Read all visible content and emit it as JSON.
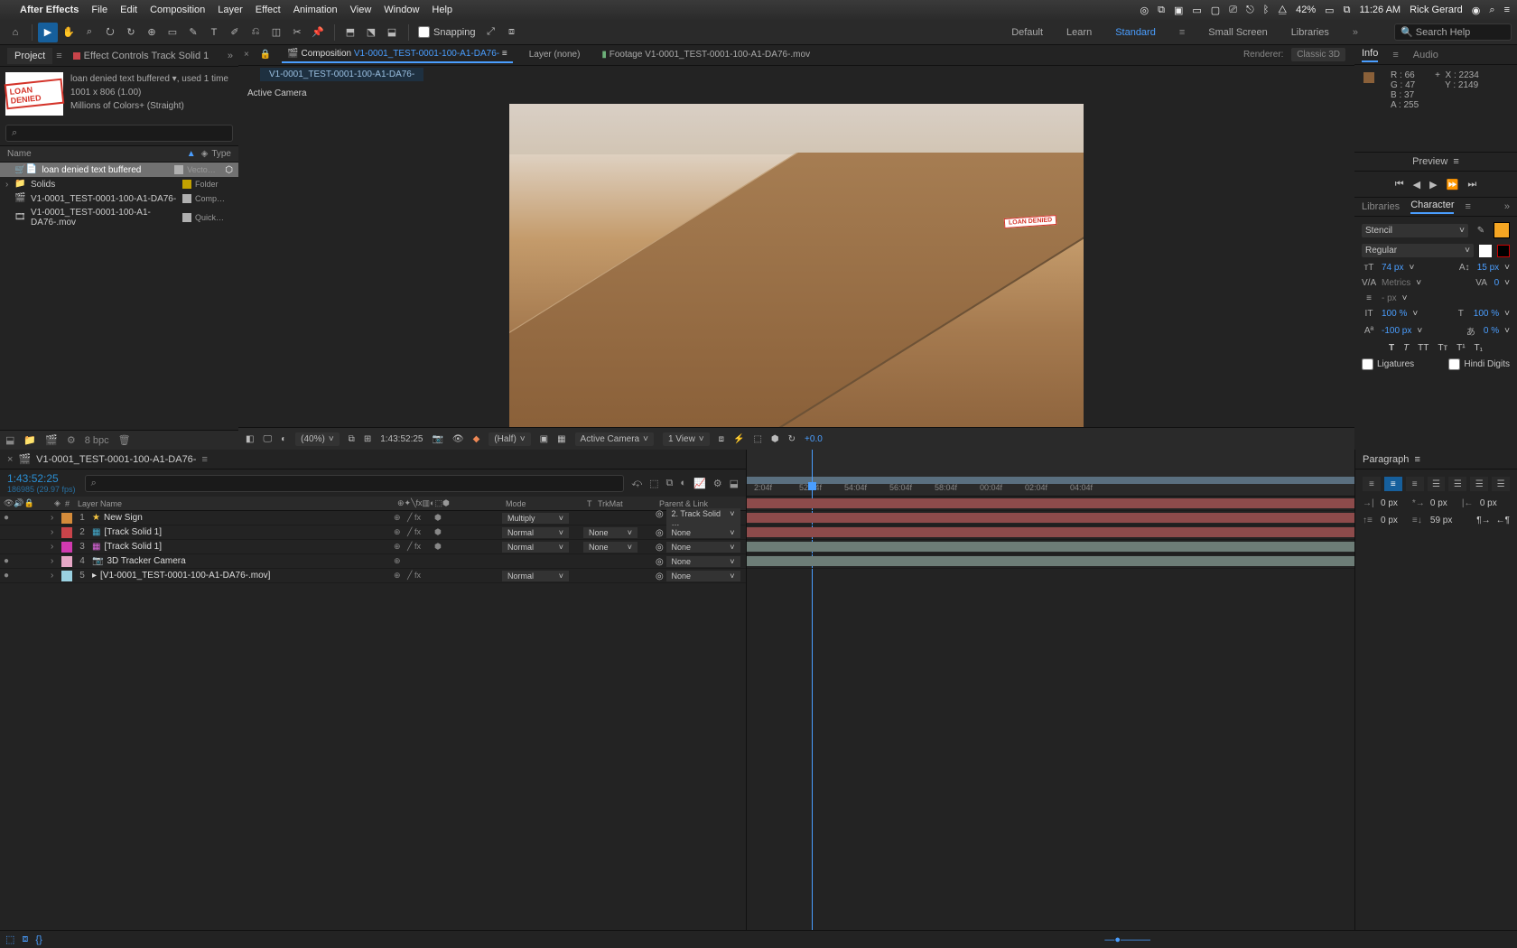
{
  "menubar": {
    "apple": "",
    "app_name": "After Effects",
    "items": [
      "File",
      "Edit",
      "Composition",
      "Layer",
      "Effect",
      "Animation",
      "View",
      "Window",
      "Help"
    ],
    "status": {
      "battery": "42%",
      "time": "11:26 AM",
      "user": "Rick Gerard"
    }
  },
  "toolbar": {
    "snapping_label": "Snapping",
    "snapping_checked": false,
    "workspaces": [
      "Default",
      "Learn",
      "Standard",
      "Small Screen",
      "Libraries"
    ],
    "selected_workspace": "Standard",
    "search_placeholder": "Search Help"
  },
  "project": {
    "tabs": [
      "Project",
      "Effect Controls Track Solid 1"
    ],
    "tab_active": 0,
    "item_name": "loan denied text buffered",
    "item_meta1": ", used 1 time",
    "item_meta2": "1001 x 806 (1.00)",
    "item_meta3": "Millions of Colors+ (Straight)",
    "thumb_text": "LOAN DENIED",
    "search_placeholder": "",
    "cols": [
      "Name",
      "Type"
    ],
    "items": [
      {
        "tw": "",
        "icon": "vector",
        "color": "#B0B0B0",
        "name": "loan denied text buffered",
        "type": "Vecto…",
        "sel": true
      },
      {
        "tw": "›",
        "icon": "folder",
        "color": "#C2A100",
        "name": "Solids",
        "type": "Folder",
        "sel": false
      },
      {
        "tw": "",
        "icon": "comp",
        "color": "#B0B0B0",
        "name": "V1-0001_TEST-0001-100-A1-DA76-",
        "type": "Comp…",
        "sel": false
      },
      {
        "tw": "",
        "icon": "mov",
        "color": "#B0B0B0",
        "name": "V1-0001_TEST-0001-100-A1-DA76-.mov",
        "type": "Quick…",
        "sel": false
      }
    ],
    "footer_bpc": "8 bpc"
  },
  "viewer": {
    "tabs": [
      {
        "label": "Composition ",
        "link": "V1-0001_TEST-0001-100-A1-DA76-",
        "active": true
      },
      {
        "label": "Layer (none)",
        "link": "",
        "active": false
      },
      {
        "label": "Footage V1-0001_TEST-0001-100-A1-DA76-.mov",
        "link": "",
        "active": false
      }
    ],
    "renderer_label": "Renderer:",
    "renderer_value": "Classic 3D",
    "subtab": "V1-0001_TEST-0001-100-A1-DA76-",
    "active_camera": "Active Camera",
    "loan_tag": "LOAN DENIED",
    "footer": {
      "zoom": "(40%)",
      "timecode": "1:43:52:25",
      "res": "(Half)",
      "camera": "Active Camera",
      "views": "1 View",
      "exposure": "+0.0"
    }
  },
  "info": {
    "tabs": [
      "Info",
      "Audio"
    ],
    "R": "66",
    "G": "47",
    "B": "37",
    "A": "255",
    "X": "2234",
    "Y": "2149"
  },
  "preview": {
    "title": "Preview"
  },
  "character": {
    "tabs": [
      "Libraries",
      "Character"
    ],
    "font": "Stencil",
    "style": "Regular",
    "size": "74 px",
    "leading": "15 px",
    "kerning": "Metrics",
    "tracking": "0",
    "stroke": "- px",
    "vscale": "100 %",
    "hscale": "100 %",
    "baseline": "-100 px",
    "tsume": "0 %",
    "ligatures": "Ligatures",
    "hindi": "Hindi Digits"
  },
  "timeline": {
    "tab": "V1-0001_TEST-0001-100-A1-DA76-",
    "timecode": "1:43:52:25",
    "timecode_sub": "186985 (29.97 fps)",
    "search_placeholder": "",
    "cols": [
      "",
      "#",
      "Layer Name",
      "Mode",
      "T",
      "TrkMat",
      "Parent & Link"
    ],
    "ruler": [
      "2:04f",
      "52:04f",
      "54:04f",
      "56:04f",
      "58:04f",
      "00:04f",
      "02:04f",
      "04:04f"
    ],
    "layers": [
      {
        "vis": "●",
        "num": "1",
        "sw": "#d48b3a",
        "name": "New Sign",
        "pref": "★",
        "mode": "Multiply",
        "trk": "",
        "parent": "2. Track Solid …",
        "bar": "#8d4b4b"
      },
      {
        "vis": "",
        "num": "2",
        "sw": "#c9444a",
        "name": "[Track Solid 1]",
        "pref": "▦",
        "mode": "Normal",
        "trk": "None",
        "parent": "None",
        "bar": "#8d4b4b"
      },
      {
        "vis": "",
        "num": "3",
        "sw": "#d13ab0",
        "name": "[Track Solid 1]",
        "pref": "▦",
        "mode": "Normal",
        "trk": "None",
        "parent": "None",
        "bar": "#8d4b4b"
      },
      {
        "vis": "●",
        "num": "4",
        "sw": "#e7a7c6",
        "name": "3D Tracker Camera",
        "pref": "📷",
        "mode": "",
        "trk": "",
        "parent": "None",
        "bar": "#6d7d77"
      },
      {
        "vis": "●",
        "num": "5",
        "sw": "#9ad1e1",
        "name": "[V1-0001_TEST-0001-100-A1-DA76-.mov]",
        "pref": "▸",
        "mode": "Normal",
        "trk": "",
        "parent": "None",
        "bar": "#6d7d77"
      }
    ]
  },
  "paragraph": {
    "title": "Paragraph",
    "indent_left": "0 px",
    "indent_right": "0 px",
    "indent_first": "0 px",
    "space_before": "0 px",
    "space_after": "59 px"
  }
}
